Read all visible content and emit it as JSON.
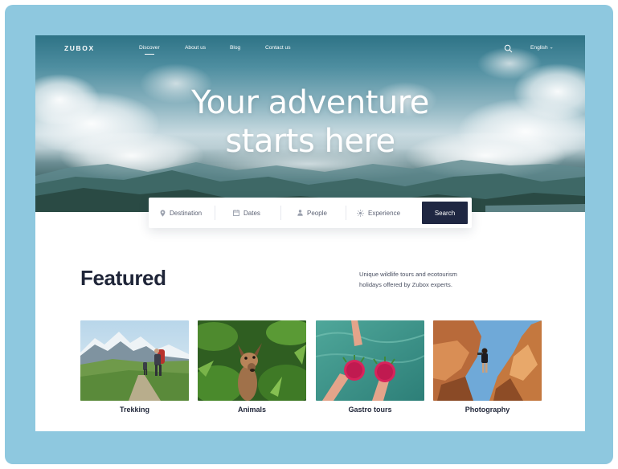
{
  "brand": {
    "logo": "ZUBOX"
  },
  "nav": {
    "links": [
      {
        "label": "Discover"
      },
      {
        "label": "About us"
      },
      {
        "label": "Blog"
      },
      {
        "label": "Contact us"
      }
    ],
    "active": "Discover",
    "search_icon": "search-icon",
    "language": "English",
    "language_icon": "chevron-down-icon"
  },
  "hero": {
    "title_line1": "Your adventure",
    "title_line2": "starts here"
  },
  "search": {
    "fields": [
      {
        "label": "Destination",
        "icon": "location-pin-icon"
      },
      {
        "label": "Dates",
        "icon": "calendar-icon"
      },
      {
        "label": "People",
        "icon": "person-icon"
      },
      {
        "label": "Experience",
        "icon": "sun-icon"
      }
    ],
    "button_label": "Search"
  },
  "featured": {
    "title": "Featured",
    "description": "Unique wildlife tours and ecotourism holidays offered by Zubox experts.",
    "cards": [
      {
        "label": "Trekking"
      },
      {
        "label": "Animals"
      },
      {
        "label": "Gastro tours"
      },
      {
        "label": "Photography"
      }
    ]
  },
  "colors": {
    "frame": "#8ec8df",
    "accent_dark": "#1f2742",
    "text_dark": "#1f2538",
    "text_muted": "#4a5062"
  }
}
